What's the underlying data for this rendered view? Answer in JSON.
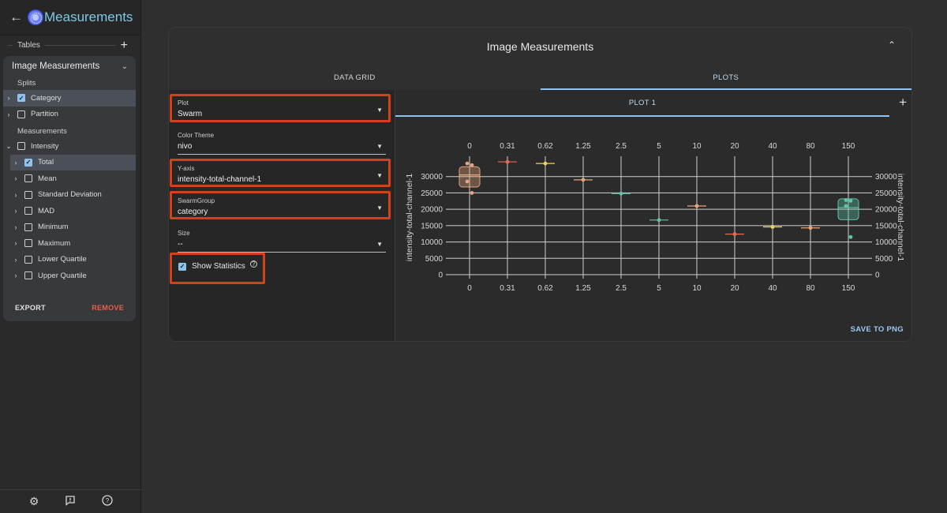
{
  "app": {
    "title": "Measurements"
  },
  "sidebar": {
    "tables_label": "Tables",
    "table_card": {
      "title": "Image Measurements",
      "splits_label": "Splits",
      "splits": [
        {
          "label": "Category",
          "checked": true
        },
        {
          "label": "Partition",
          "checked": false
        }
      ],
      "measurements_label": "Measurements",
      "measurements_parent": {
        "label": "Intensity",
        "checked": false
      },
      "measurements": [
        {
          "label": "Total",
          "checked": true
        },
        {
          "label": "Mean",
          "checked": false
        },
        {
          "label": "Standard Deviation",
          "checked": false
        },
        {
          "label": "MAD",
          "checked": false
        },
        {
          "label": "Minimum",
          "checked": false
        },
        {
          "label": "Maximum",
          "checked": false
        },
        {
          "label": "Lower Quartile",
          "checked": false
        },
        {
          "label": "Upper Quartile",
          "checked": false
        }
      ],
      "export_label": "EXPORT",
      "remove_label": "REMOVE"
    }
  },
  "panel": {
    "title": "Image Measurements",
    "tabs": [
      "DATA GRID",
      "PLOTS"
    ],
    "active_tab": "PLOTS",
    "plot_tab_label": "PLOT 1",
    "save_label": "SAVE TO PNG",
    "form": {
      "plot": {
        "label": "Plot",
        "value": "Swarm"
      },
      "color_theme": {
        "label": "Color Theme",
        "value": "nivo"
      },
      "y_axis": {
        "label": "Y-axis",
        "value": "intensity-total-channel-1"
      },
      "swarm_group": {
        "label": "SwarmGroup",
        "value": "category"
      },
      "size": {
        "label": "Size",
        "value": "--"
      },
      "show_statistics": {
        "label": "Show Statistics",
        "checked": true
      }
    }
  },
  "colors": {
    "accent": "#8fc3ef",
    "highlight": "#d4401c",
    "remove": "#e5604a"
  },
  "chart_data": {
    "type": "scatter",
    "categories": [
      "0",
      "0.31",
      "0.62",
      "1.25",
      "2.5",
      "5",
      "10",
      "20",
      "40",
      "80",
      "150"
    ],
    "ylabel": "intensity-total-channel-1",
    "ylim": [
      0,
      30000
    ],
    "yticks": [
      0,
      5000,
      10000,
      15000,
      20000,
      25000,
      30000
    ],
    "points": [
      {
        "category": "0",
        "values": [
          34000,
          33500,
          28500,
          25000
        ],
        "color": "#e8a57a"
      },
      {
        "category": "0.31",
        "values": [
          34500
        ],
        "color": "#e86a55"
      },
      {
        "category": "0.62",
        "values": [
          34000
        ],
        "color": "#f2d35a"
      },
      {
        "category": "1.25",
        "values": [
          29000
        ],
        "color": "#e8a57a"
      },
      {
        "category": "2.5",
        "values": [
          24800
        ],
        "color": "#5fc4a8"
      },
      {
        "category": "5",
        "values": [
          16700
        ],
        "color": "#5fc4a8"
      },
      {
        "category": "10",
        "values": [
          21000
        ],
        "color": "#e8a57a"
      },
      {
        "category": "20",
        "values": [
          12400
        ],
        "color": "#e86a55"
      },
      {
        "category": "40",
        "values": [
          14600
        ],
        "color": "#f2d35a"
      },
      {
        "category": "80",
        "values": [
          14300
        ],
        "color": "#e8a57a"
      },
      {
        "category": "150",
        "values": [
          22800,
          22600,
          21000,
          11500
        ],
        "color": "#5fc4a8"
      }
    ],
    "boxes": [
      {
        "category": "0",
        "q1": 26800,
        "median": 30500,
        "q3": 33000,
        "color": "#e8a57a"
      },
      {
        "category": "150",
        "q1": 16800,
        "median": 20500,
        "q3": 23200,
        "color": "#5fc4a8"
      }
    ]
  }
}
